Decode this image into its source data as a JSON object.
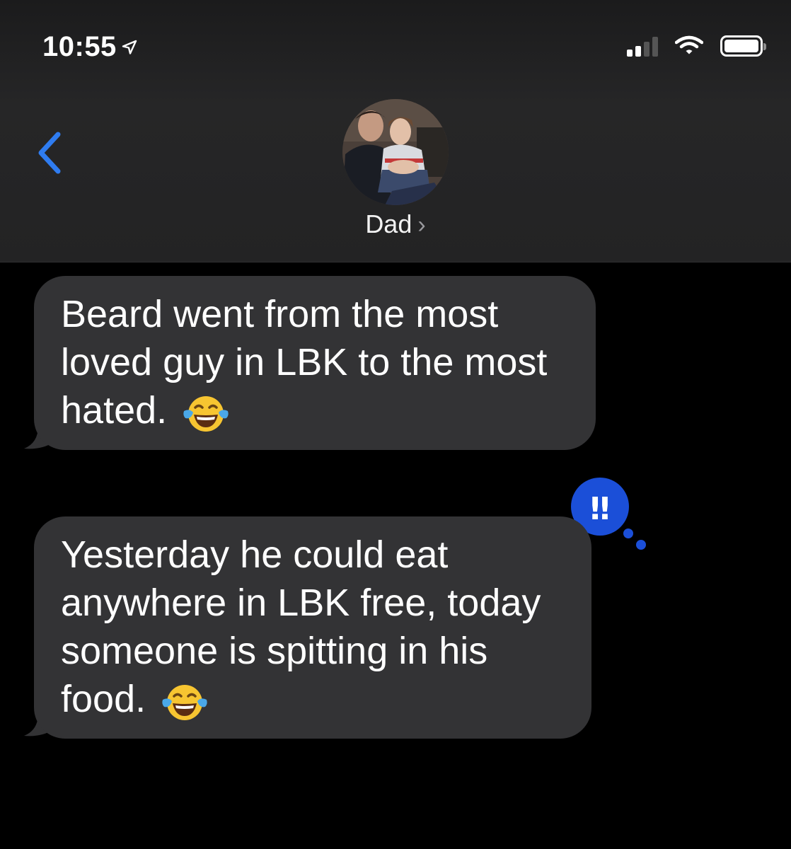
{
  "status_bar": {
    "time": "10:55"
  },
  "header": {
    "contact_name": "Dad",
    "chevron": "›"
  },
  "messages": [
    {
      "direction": "incoming",
      "text": "Beard went from the most loved guy in LBK to the most hated.",
      "lines": [
        "Beard went from the most",
        "loved guy in LBK to the most",
        "hated."
      ],
      "emoji": "face-with-tears-of-joy"
    },
    {
      "direction": "incoming",
      "text": "Yesterday he could eat anywhere in LBK free, today someone is spitting in his food.",
      "lines": [
        "Yesterday he could eat",
        "anywhere in LBK free, today",
        "someone is spitting in his",
        "food."
      ],
      "emoji": "face-with-tears-of-joy",
      "tapback": "‼"
    }
  ],
  "colors": {
    "accent": "#1f7bea",
    "bubble_incoming": "#333335",
    "tapback": "#1b4fd8"
  }
}
